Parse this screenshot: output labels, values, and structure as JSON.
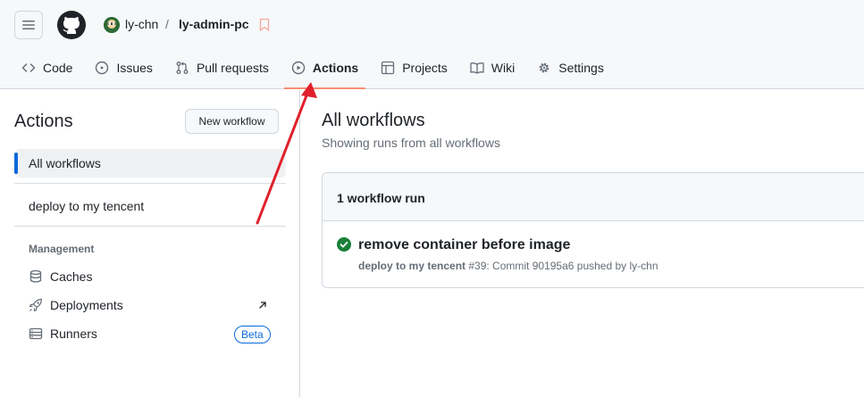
{
  "repo": {
    "owner": "ly-chn",
    "separator": "/",
    "name": "ly-admin-pc"
  },
  "tabs": [
    {
      "label": "Code",
      "icon": "code-icon"
    },
    {
      "label": "Issues",
      "icon": "issue-icon"
    },
    {
      "label": "Pull requests",
      "icon": "pull-request-icon"
    },
    {
      "label": "Actions",
      "icon": "play-icon",
      "active": true
    },
    {
      "label": "Projects",
      "icon": "table-icon"
    },
    {
      "label": "Wiki",
      "icon": "book-icon"
    },
    {
      "label": "Settings",
      "icon": "gear-icon"
    }
  ],
  "sidebar": {
    "title": "Actions",
    "new_workflow_label": "New workflow",
    "all_workflows": "All workflows",
    "workflows": [
      "deploy to my tencent"
    ],
    "management_heading": "Management",
    "management": [
      {
        "label": "Caches",
        "icon": "database-icon"
      },
      {
        "label": "Deployments",
        "icon": "rocket-icon"
      },
      {
        "label": "Runners",
        "icon": "server-icon",
        "badge": "Beta"
      }
    ]
  },
  "main": {
    "title": "All workflows",
    "subtitle": "Showing runs from all workflows",
    "runs_count_label": "1 workflow run",
    "runs": [
      {
        "title": "remove container before image",
        "workflow": "deploy to my tencent",
        "meta": " #39: Commit 90195a6 pushed by ly-chn",
        "status": "success"
      }
    ]
  },
  "colors": {
    "accent_underline": "#fd8c73",
    "selected_bar": "#0969da",
    "success": "#1a7f37",
    "annotation_arrow": "#e0202b"
  }
}
